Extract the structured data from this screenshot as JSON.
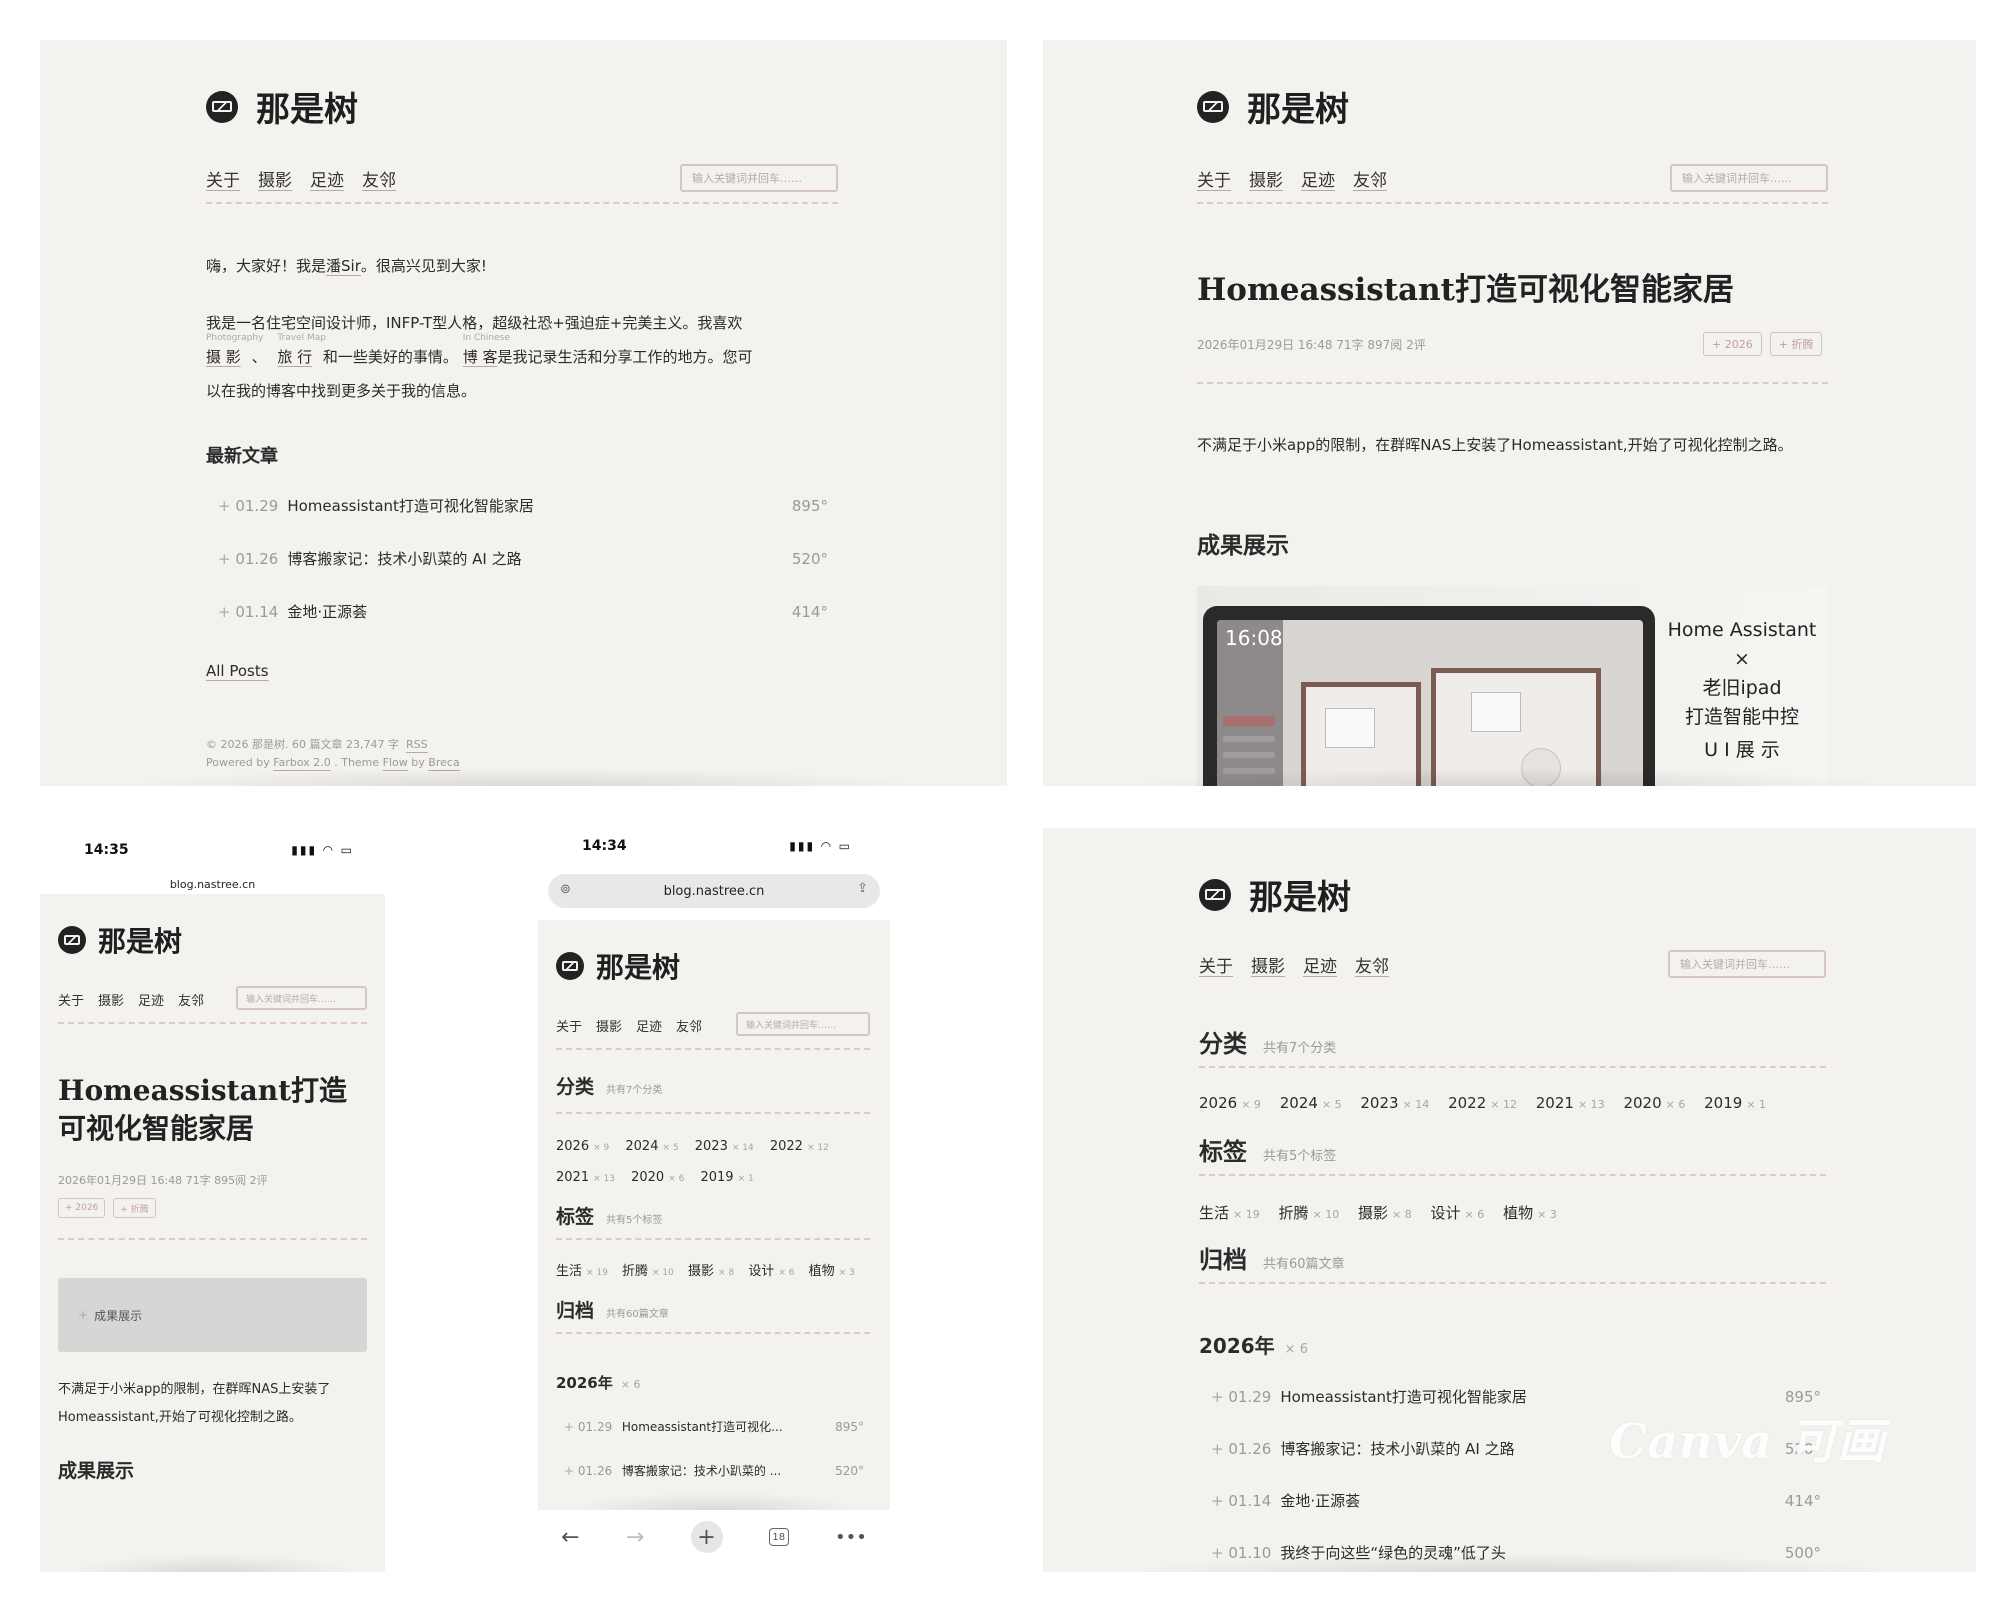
{
  "site": {
    "name": "那是树"
  },
  "nav": {
    "about": "关于",
    "photo": "摄影",
    "travel": "足迹",
    "friends": "友邻"
  },
  "search": {
    "placeholder": "输入关键词并回车……"
  },
  "home": {
    "greeting_pre": "嗨，大家好！我是",
    "greeting_name": "潘Sir",
    "greeting_post": "。很高兴见到大家!",
    "intro_line1": "我是一名住宅空间设计师，INFP-T型人格，超级社恐+强迫症+完美主义。我喜欢",
    "photo_ruby": "Photography",
    "photo_word": "摄 影",
    "sep": "、",
    "travel_ruby": "Travel Map",
    "travel_word": "旅 行",
    "mid": "和一些美好的事情。",
    "blog_ruby": "In Chinese",
    "blog_word": "博 客",
    "tail": "是我记录生活和分享工作的地方。您可",
    "intro_line3": "以在我的博客中找到更多关于我的信息。",
    "latest_title": "最新文章",
    "posts": [
      {
        "date": "01.29",
        "title": "Homeassistant打造可视化智能家居",
        "views": "895°"
      },
      {
        "date": "01.26",
        "title": "博客搬家记：技术小趴菜的 AI 之路",
        "views": "520°"
      },
      {
        "date": "01.14",
        "title": "金地·正源荟",
        "views": "414°"
      }
    ],
    "all_posts": "All Posts",
    "footer_line1": "© 2026 那是树. 60 篇文章   23,747 字",
    "footer_rss": "RSS",
    "footer_powered": "Powered by",
    "footer_farbox": "Farbox 2.0",
    "footer_theme": ". Theme",
    "footer_flow": "Flow",
    "footer_by": "by",
    "footer_breca": "Breca"
  },
  "article": {
    "title": "Homeassistant打造可视化智能家居",
    "mobile_title": "Homeassistant打造可视化智能家居",
    "meta": "2026年01月29日 16:48   71字   897阅   2评",
    "mobile_meta": "2026年01月29日 16:48   71字   895阅   2评",
    "tags": [
      "+ 2026",
      "+ 折腾"
    ],
    "lead": "不满足于小米app的限制，在群晖NAS上安装了Homeassistant,开始了可视化控制之路。",
    "mobile_lead_1": "不满足于小米app的限制，在群晖NAS上安装了",
    "mobile_lead_2": "Homeassistant,开始了可视化控制之路。",
    "h2": "成果展示",
    "toc_item": "成果展示",
    "hero": {
      "clock": "16:08",
      "line1": "Home Assistant",
      "line2": "×",
      "line3": "老旧ipad",
      "line4": "打造智能中控",
      "line5": "U I 展 示"
    }
  },
  "archive": {
    "categories_title": "分类",
    "categories_sub": "共有7个分类",
    "years": [
      {
        "name": "2026",
        "count": "× 9"
      },
      {
        "name": "2024",
        "count": "× 5"
      },
      {
        "name": "2023",
        "count": "× 14"
      },
      {
        "name": "2022",
        "count": "× 12"
      },
      {
        "name": "2021",
        "count": "× 13"
      },
      {
        "name": "2020",
        "count": "× 6"
      },
      {
        "name": "2019",
        "count": "× 1"
      }
    ],
    "tags_title": "标签",
    "tags_sub": "共有5个标签",
    "tags": [
      {
        "name": "生活",
        "count": "× 19"
      },
      {
        "name": "折腾",
        "count": "× 10"
      },
      {
        "name": "摄影",
        "count": "× 8"
      },
      {
        "name": "设计",
        "count": "× 6"
      },
      {
        "name": "植物",
        "count": "× 3"
      }
    ],
    "archive_title": "归档",
    "archive_sub": "共有60篇文章",
    "year_title": "2026年",
    "year_count": "× 6",
    "posts": [
      {
        "date": "01.29",
        "title": "Homeassistant打造可视化智能家居",
        "views": "895°"
      },
      {
        "date": "01.26",
        "title": "博客搬家记：技术小趴菜的 AI 之路",
        "views": "520°"
      },
      {
        "date": "01.14",
        "title": "金地·正源荟",
        "views": "414°"
      },
      {
        "date": "01.10",
        "title": "我终于向这些“绿色的灵魂”低了头",
        "views": "500°"
      }
    ],
    "mobile_posts": [
      {
        "date": "01.29",
        "title": "Homeassistant打造可视化...",
        "views": "895°"
      },
      {
        "date": "01.26",
        "title": "博客搬家记：技术小趴菜的 ...",
        "views": "520°"
      }
    ]
  },
  "phone1": {
    "time": "14:35",
    "url": "blog.nastree.cn"
  },
  "phone2": {
    "time": "14:34",
    "url": "blog.nastree.cn",
    "tabs": "18"
  },
  "watermark": "Canva 可画"
}
